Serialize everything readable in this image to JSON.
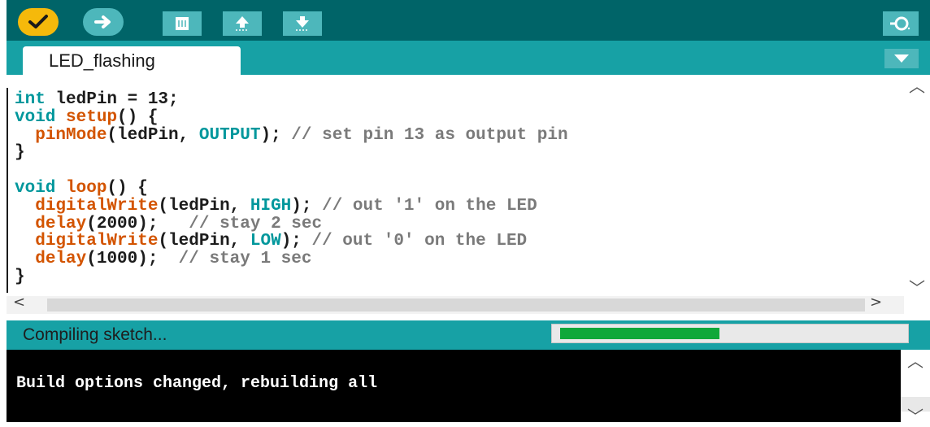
{
  "toolbar": {
    "buttons": [
      {
        "name": "verify",
        "icon": "checkmark-icon"
      },
      {
        "name": "upload",
        "icon": "arrow-right-icon"
      },
      {
        "name": "new",
        "icon": "new-sketch-icon"
      },
      {
        "name": "open",
        "icon": "arrow-up-icon"
      },
      {
        "name": "save",
        "icon": "arrow-down-icon"
      },
      {
        "name": "serial-monitor",
        "icon": "magnifier-icon"
      }
    ]
  },
  "tab": {
    "label": "LED_flashing"
  },
  "editor": {
    "lines": [
      [
        {
          "t": "int",
          "c": "kw"
        },
        {
          "t": " ledPin = 13;",
          "c": "ltxt"
        }
      ],
      [
        {
          "t": "void",
          "c": "kw"
        },
        {
          "t": " ",
          "c": "ltxt"
        },
        {
          "t": "setup",
          "c": "fn"
        },
        {
          "t": "() {",
          "c": "ltxt"
        }
      ],
      [
        {
          "t": "  ",
          "c": "ltxt"
        },
        {
          "t": "pinMode",
          "c": "fn"
        },
        {
          "t": "(ledPin, ",
          "c": "ltxt"
        },
        {
          "t": "OUTPUT",
          "c": "cn"
        },
        {
          "t": "); ",
          "c": "ltxt"
        },
        {
          "t": "// set pin 13 as output pin",
          "c": "cm"
        }
      ],
      [
        {
          "t": "}",
          "c": "ltxt"
        }
      ],
      [
        {
          "t": "",
          "c": "ltxt"
        }
      ],
      [
        {
          "t": "void",
          "c": "kw"
        },
        {
          "t": " ",
          "c": "ltxt"
        },
        {
          "t": "loop",
          "c": "fn"
        },
        {
          "t": "() {",
          "c": "ltxt"
        }
      ],
      [
        {
          "t": "  ",
          "c": "ltxt"
        },
        {
          "t": "digitalWrite",
          "c": "fn"
        },
        {
          "t": "(ledPin, ",
          "c": "ltxt"
        },
        {
          "t": "HIGH",
          "c": "cn"
        },
        {
          "t": "); ",
          "c": "ltxt"
        },
        {
          "t": "// out '1' on the LED",
          "c": "cm"
        }
      ],
      [
        {
          "t": "  ",
          "c": "ltxt"
        },
        {
          "t": "delay",
          "c": "fn"
        },
        {
          "t": "(2000);   ",
          "c": "ltxt"
        },
        {
          "t": "// stay 2 sec",
          "c": "cm"
        }
      ],
      [
        {
          "t": "  ",
          "c": "ltxt"
        },
        {
          "t": "digitalWrite",
          "c": "fn"
        },
        {
          "t": "(ledPin, ",
          "c": "ltxt"
        },
        {
          "t": "LOW",
          "c": "cn"
        },
        {
          "t": "); ",
          "c": "ltxt"
        },
        {
          "t": "// out '0' on the LED",
          "c": "cm"
        }
      ],
      [
        {
          "t": "  ",
          "c": "ltxt"
        },
        {
          "t": "delay",
          "c": "fn"
        },
        {
          "t": "(1000);  ",
          "c": "ltxt"
        },
        {
          "t": "// stay 1 sec",
          "c": "cm"
        }
      ],
      [
        {
          "t": "}",
          "c": "ltxt"
        }
      ]
    ]
  },
  "status": {
    "text": "Compiling sketch...",
    "progress": 0.47
  },
  "console": {
    "text": "Build options changed, rebuilding all"
  },
  "colors": {
    "toolbar": "#006468",
    "tabbar": "#17a1a5",
    "verify": "#f5b90b",
    "progress": "#0fa83a"
  }
}
